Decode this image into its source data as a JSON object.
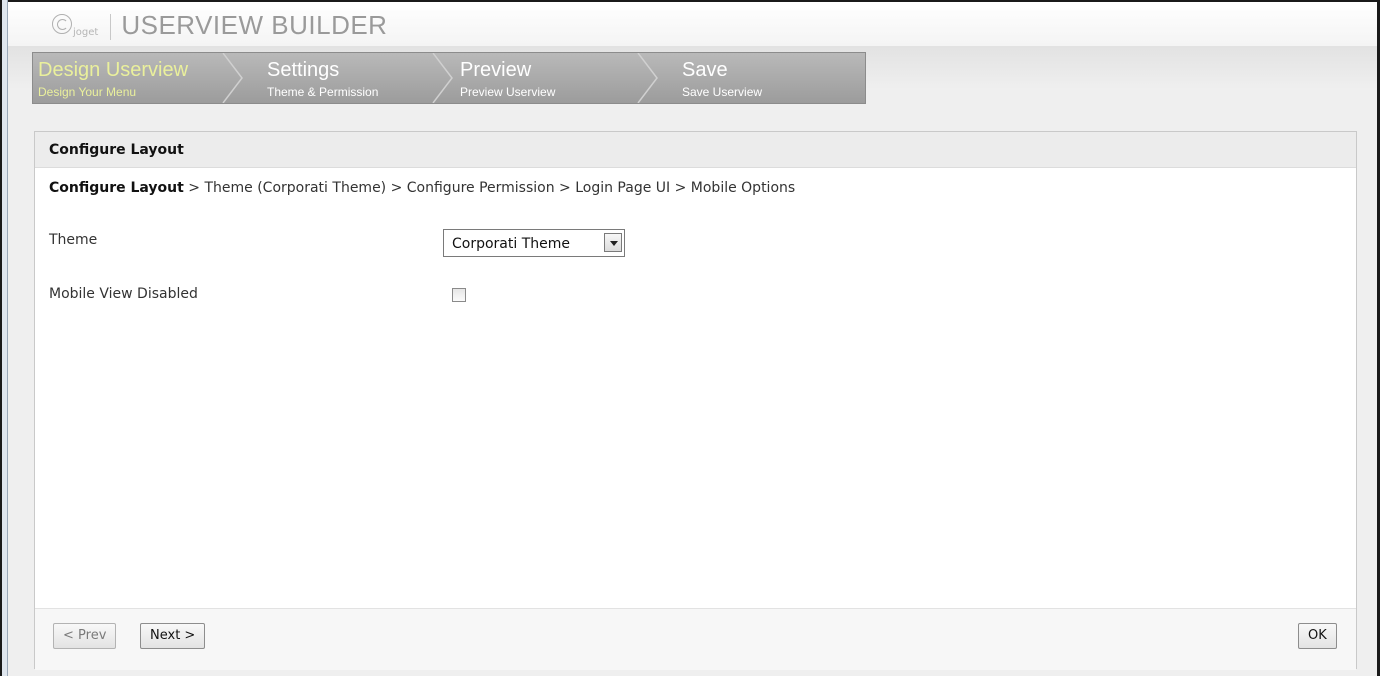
{
  "header": {
    "logo_text": "joget",
    "app_title": "USERVIEW BUILDER"
  },
  "wizard": {
    "steps": [
      {
        "title": "Design Userview",
        "subtitle": "Design Your Menu",
        "active": true
      },
      {
        "title": "Settings",
        "subtitle": "Theme & Permission",
        "active": false
      },
      {
        "title": "Preview",
        "subtitle": "Preview Userview",
        "active": false
      },
      {
        "title": "Save",
        "subtitle": "Save Userview",
        "active": false
      }
    ],
    "colors": {
      "active_text": "#eaf09c",
      "inactive_text": "#ffffff",
      "strip": "#a9a9a9"
    }
  },
  "panel": {
    "title": "Configure Layout",
    "breadcrumb": {
      "current": "Configure Layout",
      "rest": " > Theme (Corporati Theme) > Configure Permission > Login Page UI > Mobile Options"
    },
    "fields": {
      "theme_label": "Theme",
      "theme_value": "Corporati Theme",
      "mobile_label": "Mobile View Disabled",
      "mobile_checked": false
    },
    "footer": {
      "prev_label": "< Prev",
      "next_label": "Next >",
      "ok_label": "OK"
    }
  }
}
